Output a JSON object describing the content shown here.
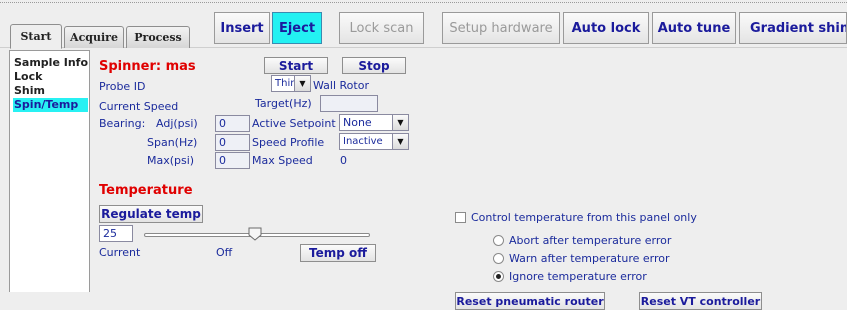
{
  "tabs": [
    "Start",
    "Acquire",
    "Process"
  ],
  "toolbar": {
    "insert": "Insert",
    "eject": "Eject",
    "lock_scan": "Lock scan",
    "setup_hardware": "Setup hardware",
    "auto_lock": "Auto lock",
    "auto_tune": "Auto tune",
    "gradient_shim": "Gradient shim"
  },
  "sidebar": {
    "items": [
      "Sample Info",
      "Lock",
      "Shim",
      "Spin/Temp"
    ],
    "selected": "Spin/Temp"
  },
  "spinner": {
    "title": "Spinner: mas",
    "start": "Start",
    "stop": "Stop",
    "probe_id_label": "Probe ID",
    "probe_value": "Thin",
    "rotor_label": "Wall Rotor",
    "current_speed_label": "Current Speed",
    "target_label": "Target(Hz)",
    "target_value": "",
    "bearing_label": "Bearing:",
    "adj_label": "Adj(psi)",
    "adj_value": "0",
    "span_label": "Span(Hz)",
    "span_value": "0",
    "max_label": "Max(psi)",
    "max_value": "0",
    "active_setpoint_label": "Active Setpoint",
    "active_setpoint_value": "None",
    "speed_profile_label": "Speed Profile",
    "speed_profile_value": "Inactive",
    "max_speed_label": "Max Speed",
    "max_speed_value": "0"
  },
  "temperature": {
    "title": "Temperature",
    "regulate": "Regulate temp",
    "value": "25",
    "slider_fraction": 0.45,
    "current_label": "Current",
    "off_label": "Off",
    "temp_off": "Temp off",
    "control_checkbox": "Control temperature from this panel only",
    "options": [
      "Abort after temperature error",
      "Warn after temperature error",
      "Ignore temperature error"
    ],
    "selected_option": 2,
    "reset_router": "Reset pneumatic router",
    "reset_vt": "Reset VT controller"
  },
  "colors": {
    "accent_cyan": "#23f1f2",
    "label_blue": "#1b2b9c",
    "title_red": "#e00000"
  }
}
